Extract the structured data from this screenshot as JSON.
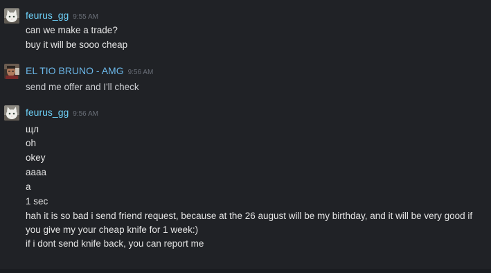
{
  "messages": [
    {
      "author": "feurus_gg",
      "time": "9:55 AM",
      "lines": [
        "can we make a trade?",
        "buy it will be sooo cheap"
      ]
    },
    {
      "author": "EL TIO BRUNO - AMG",
      "time": "9:56 AM",
      "lines": [
        "send me offer and I'll check"
      ]
    },
    {
      "author": "feurus_gg",
      "time": "9:56 AM",
      "lines": [
        "щл",
        "oh",
        "okey",
        "aaaa",
        "a",
        "1 sec",
        "hah it is so bad i send friend request, because at the 26 august will be my birthday, and it will be very good if you give my your cheap knife for 1 week:)",
        "if i dont send knife back, you can report me"
      ]
    }
  ],
  "colors": {
    "background": "#202226",
    "author_name": "#6dcff6",
    "timestamp": "#6a6f78",
    "message_text": "#e4e4e4"
  },
  "icons": {
    "avatar_feurus": "white-cat-avatar-icon",
    "avatar_bruno": "man-photo-avatar-icon"
  }
}
